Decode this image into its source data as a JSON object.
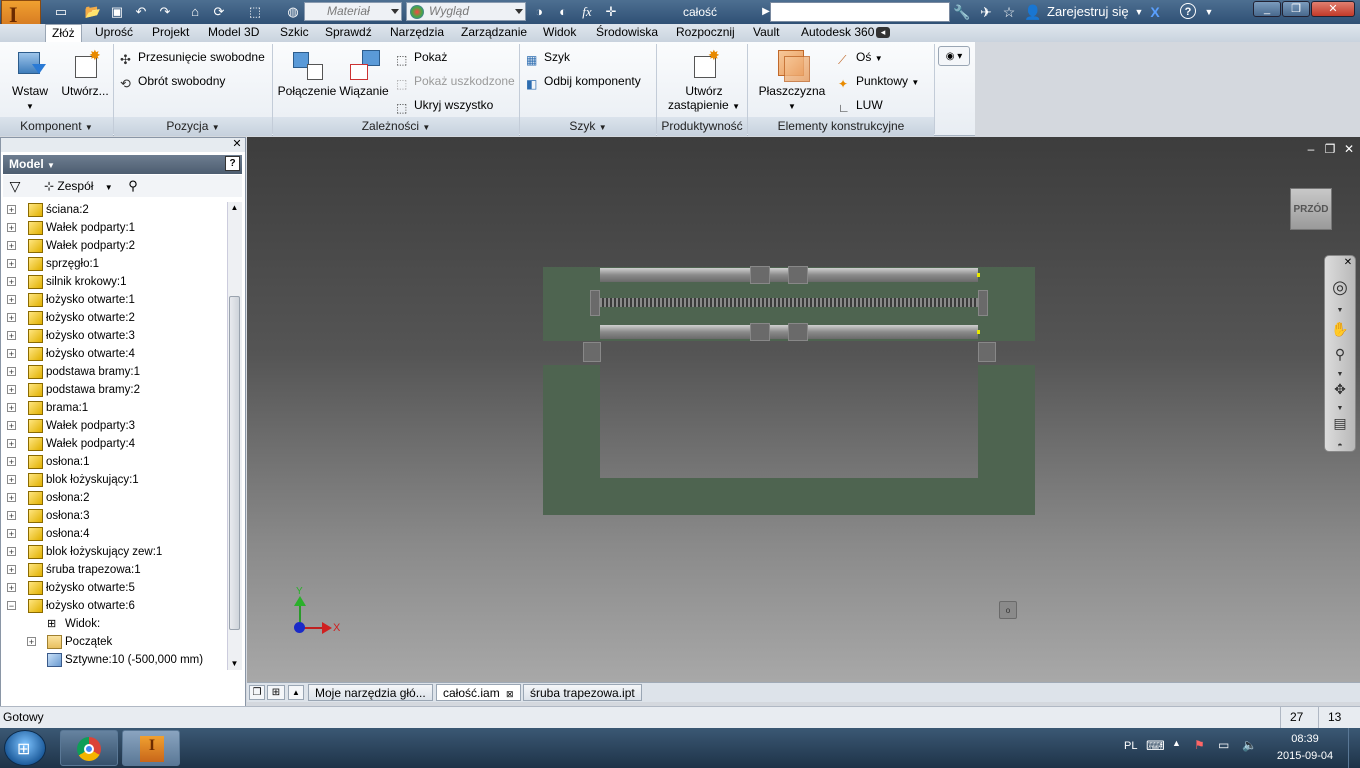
{
  "titlebar": {
    "material_placeholder": "Materiał",
    "appearance_placeholder": "Wygląd",
    "fx_label": "fx",
    "document_title": "całość",
    "sign_in": "Zarejestruj się",
    "help_label": "?"
  },
  "tabs": [
    "Złóż",
    "Uprość",
    "Projekt",
    "Model 3D",
    "Szkic",
    "Sprawdź",
    "Narzędzia",
    "Zarządzanie",
    "Widok",
    "Środowiska",
    "Rozpocznij",
    "Vault",
    "Autodesk 360"
  ],
  "ribbon": {
    "insert": "Wstaw",
    "create": "Utwórz...",
    "free_move": "Przesunięcie swobodne",
    "free_rotate": "Obrót swobodny",
    "joint": "Połączenie",
    "constrain": "Wiązanie",
    "show": "Pokaż",
    "show_sick": "Pokaż uszkodzone",
    "hide_all": "Ukryj wszystko",
    "pattern": "Szyk",
    "mirror": "Odbij komponenty",
    "substitute_line1": "Utwórz",
    "substitute_line2": "zastąpienie",
    "plane": "Płaszczyzna",
    "axis": "Oś",
    "point": "Punktowy",
    "ucs": "LUW"
  },
  "panels": {
    "component": "Komponent",
    "position": "Pozycja",
    "relationships": "Zależności",
    "pattern": "Szyk",
    "productivity": "Produktywność",
    "work_features": "Elementy konstrukcyjne"
  },
  "browser": {
    "title": "Model",
    "filter_label": "Zespół",
    "items": [
      {
        "label": "ściana:2",
        "type": "part"
      },
      {
        "label": "Wałek podparty:1",
        "type": "part"
      },
      {
        "label": "Wałek podparty:2",
        "type": "part"
      },
      {
        "label": "sprzęgło:1",
        "type": "part"
      },
      {
        "label": "silnik krokowy:1",
        "type": "part"
      },
      {
        "label": "łożysko otwarte:1",
        "type": "part"
      },
      {
        "label": "łożysko otwarte:2",
        "type": "part"
      },
      {
        "label": "łożysko otwarte:3",
        "type": "part"
      },
      {
        "label": "łożysko otwarte:4",
        "type": "part"
      },
      {
        "label": "podstawa bramy:1",
        "type": "part"
      },
      {
        "label": "podstawa bramy:2",
        "type": "part"
      },
      {
        "label": "brama:1",
        "type": "part"
      },
      {
        "label": "Wałek podparty:3",
        "type": "part"
      },
      {
        "label": "Wałek podparty:4",
        "type": "part"
      },
      {
        "label": "osłona:1",
        "type": "part"
      },
      {
        "label": "blok łożyskujący:1",
        "type": "part"
      },
      {
        "label": "osłona:2",
        "type": "part"
      },
      {
        "label": "osłona:3",
        "type": "part"
      },
      {
        "label": "osłona:4",
        "type": "part"
      },
      {
        "label": "blok łożyskujący zew:1",
        "type": "part"
      },
      {
        "label": "śruba trapezowa:1",
        "type": "part"
      },
      {
        "label": "łożysko otwarte:5",
        "type": "part"
      },
      {
        "label": "łożysko otwarte:6",
        "type": "part-open"
      },
      {
        "label": "Widok:",
        "type": "child-view"
      },
      {
        "label": "Początek",
        "type": "child-folder"
      },
      {
        "label": "Sztywne:10 (-500,000 mm)",
        "type": "child-constraint"
      }
    ]
  },
  "viewport": {
    "viewcube_label": "PRZÓD",
    "axis_x": "X",
    "axis_y": "Y"
  },
  "doc_tabs": [
    "Moje narzędzia głó...",
    "całość.iam",
    "śruba trapezowa.ipt"
  ],
  "status": {
    "text": "Gotowy",
    "count1": "27",
    "count2": "13"
  },
  "taskbar": {
    "lang": "PL",
    "time": "08:39",
    "date": "2015-09-04"
  },
  "colors": {
    "model_green": "#4e6450",
    "title_bar": "#3d5f82"
  }
}
